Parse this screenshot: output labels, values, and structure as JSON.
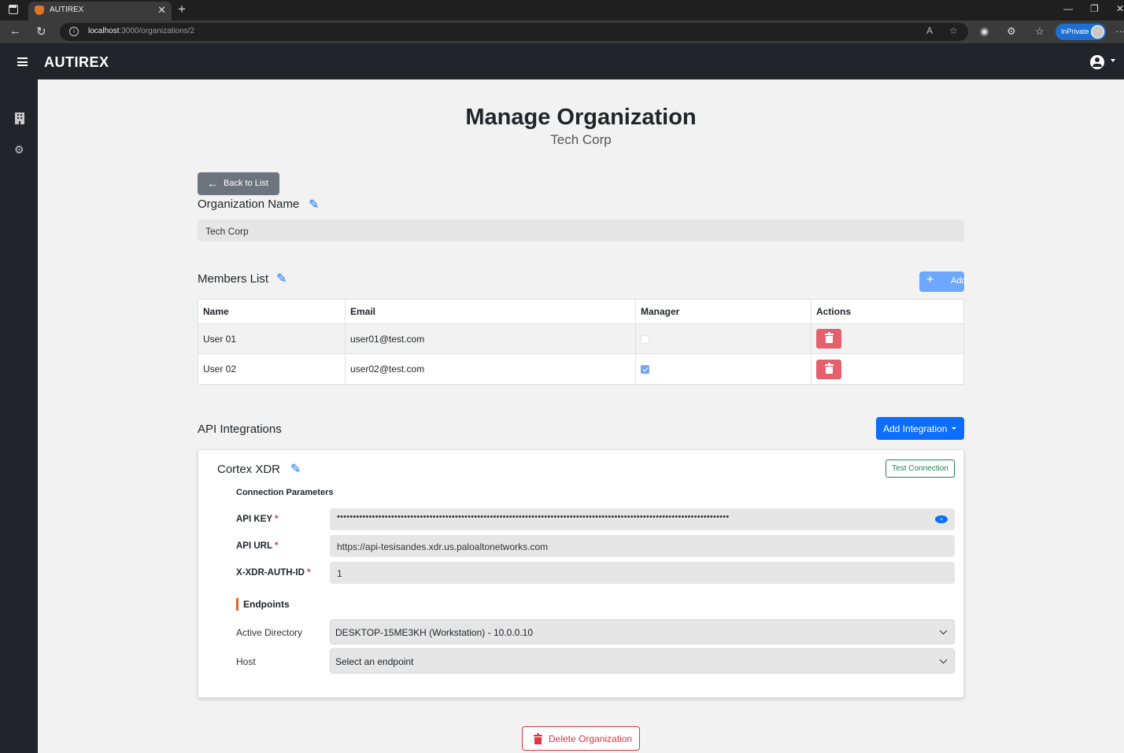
{
  "browser": {
    "tab_title": "AUTIREX",
    "url_host": "localhost",
    "url_path": ":3000/organizations/2",
    "inprivate_label": "InPrivate"
  },
  "navbar": {
    "brand": "AUTIREX"
  },
  "page": {
    "title": "Manage Organization",
    "subtitle": "Tech Corp",
    "back_label": "Back to List"
  },
  "org_name": {
    "label": "Organization Name",
    "value": "Tech Corp"
  },
  "members": {
    "label": "Members List",
    "add_label": "Add",
    "columns": [
      "Name",
      "Email",
      "Manager",
      "Actions"
    ],
    "rows": [
      {
        "name": "User 01",
        "email": "user01@test.com",
        "manager": false
      },
      {
        "name": "User 02",
        "email": "user02@test.com",
        "manager": true
      }
    ]
  },
  "integrations": {
    "label": "API Integrations",
    "add_label": "Add Integration",
    "card": {
      "title": "Cortex XDR",
      "test_label": "Test Connection",
      "params_label": "Connection Parameters",
      "fields": [
        {
          "label": "API KEY",
          "required": "*",
          "value": "•••••••••••••••••••••••••••••••••••••••••••••••••••••••••••••••••••••••••••••••••••••••••••••••••••••••••••••••••••••••••••"
        },
        {
          "label": "API URL",
          "required": "*",
          "value": "https://api-tesisandes.xdr.us.paloaltonetworks.com"
        },
        {
          "label": "X-XDR-AUTH-ID",
          "required": "*",
          "value": "1"
        }
      ],
      "endpoints_label": "Endpoints",
      "endpoints": [
        {
          "label": "Active Directory",
          "value": "DESKTOP-15ME3KH (Workstation) - 10.0.0.10"
        },
        {
          "label": "Host",
          "value": "Select an endpoint"
        }
      ]
    }
  },
  "delete_label": "Delete Organization",
  "colors": {
    "primary": "#0d6efd",
    "secondary": "#6c757d",
    "danger": "#dc3545",
    "success": "#198754",
    "navbar": "#212529"
  }
}
